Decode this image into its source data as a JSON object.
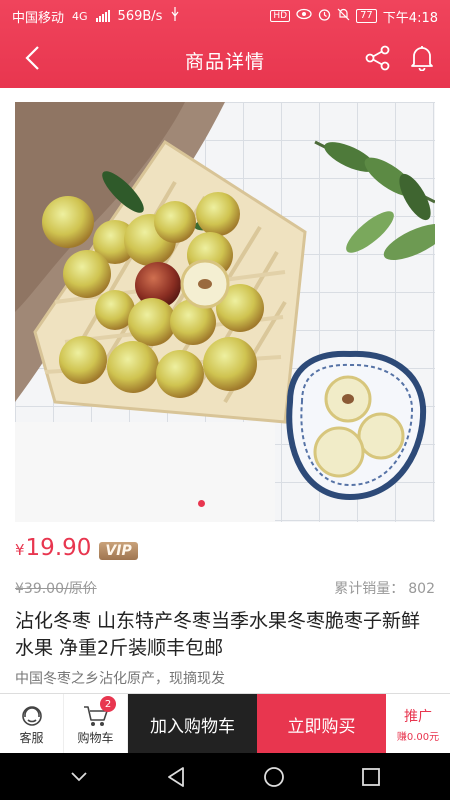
{
  "status_bar": {
    "carrier": "中国移动",
    "network": "4G",
    "speed": "569B/s",
    "battery": "77",
    "time": "下午4:18"
  },
  "nav": {
    "title": "商品详情",
    "back_icon": "back-icon",
    "share_icon": "share-icon",
    "bell_icon": "bell-icon"
  },
  "gallery": {
    "active_slide": 1,
    "slide_count": 1
  },
  "product": {
    "currency": "¥",
    "price": "19.90",
    "vip_label": "VIP",
    "original_price": "¥39.00/原价",
    "sales_label": "累计销量：",
    "sales_count": "802",
    "title": "沾化冬枣 山东特产冬枣当季水果冬枣脆枣子新鲜水果 净重2斤装顺丰包邮",
    "subtitle": "中国冬枣之乡沾化原产，现摘现发"
  },
  "bottom_bar": {
    "service_label": "客服",
    "cart_label": "购物车",
    "cart_count": "2",
    "add_to_cart": "加入购物车",
    "buy_now": "立即购买",
    "promote_label": "推广",
    "promote_earn": "赚0.00元"
  },
  "colors": {
    "accent": "#e8364f",
    "dark_button": "#222222",
    "vip_gold": "#b08560"
  }
}
